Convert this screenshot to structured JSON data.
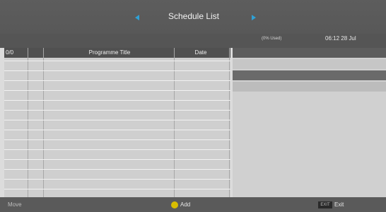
{
  "header": {
    "title": "Schedule List"
  },
  "subbar": {
    "used": "(0% Used)",
    "clock": "06:12 28 Jul"
  },
  "list": {
    "counter": "0/0",
    "col_title": "Programme Title",
    "col_date": "Date"
  },
  "footer": {
    "move": "Move",
    "add": "Add",
    "exit": "Exit",
    "exit_badge": "EXIT"
  },
  "colors": {
    "accent_arrows": "#2ea1d6",
    "yellow_button": "#d8bd00"
  }
}
